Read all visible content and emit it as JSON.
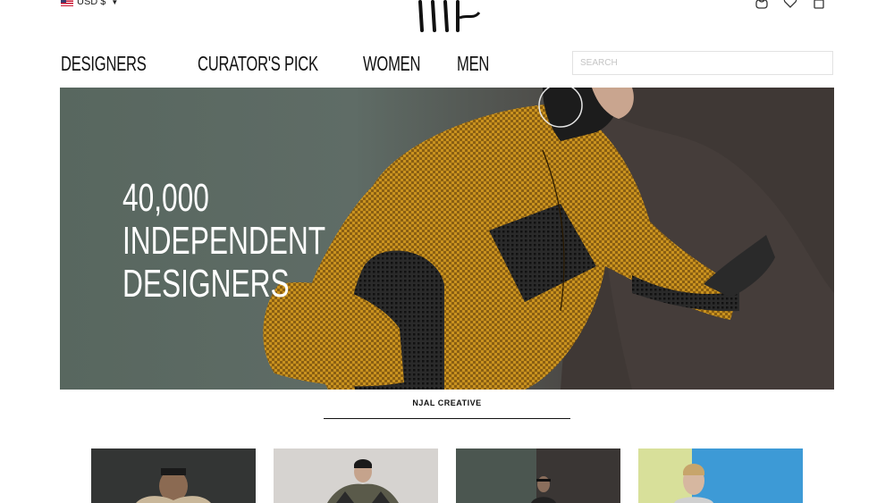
{
  "header": {
    "currency": "USD $",
    "logo": "NJAL logo",
    "icons": [
      "user-icon",
      "heart-icon",
      "bag-icon"
    ]
  },
  "nav": {
    "items": [
      "DESIGNERS",
      "CURATOR'S PICK",
      "WOMEN",
      "MEN"
    ]
  },
  "search": {
    "placeholder": "SEARCH"
  },
  "hero": {
    "line1": "40,000",
    "line2": "INDEPENDENT",
    "line3": "DESIGNERS",
    "caption": "NJAL CREATIVE"
  },
  "colors": {
    "hero_left": "#5d6a64",
    "jacket_mustard": "#c9921f",
    "jacket_black": "#2a2a2a",
    "wall_dark": "#3d3532"
  },
  "thumbnails": [
    "thumbnail-1",
    "thumbnail-2",
    "thumbnail-3",
    "thumbnail-4"
  ]
}
